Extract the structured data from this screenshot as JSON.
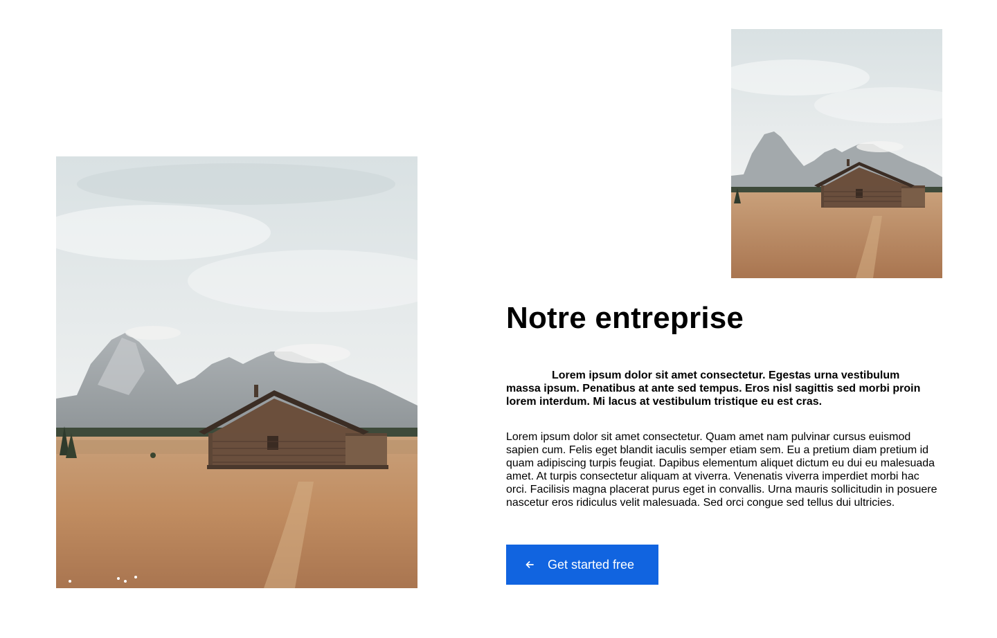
{
  "section": {
    "title": "Notre entreprise",
    "lead": "Lorem ipsum dolor sit amet consectetur. Egestas urna vestibulum massa ipsum. Penatibus at ante sed tempus. Eros nisl sagittis sed morbi proin lorem interdum. Mi lacus at vestibulum tristique eu est cras.",
    "body": "Lorem ipsum dolor sit amet consectetur. Quam amet nam pulvinar cursus euismod sapien cum. Felis eget blandit iaculis semper etiam sem. Eu a pretium diam pretium id quam adipiscing turpis feugiat. Dapibus elementum aliquet dictum eu dui eu malesuada amet. At turpis consectetur aliquam at viverra. Venenatis viverra imperdiet morbi hac orci. Facilisis magna placerat purus eget in convallis. Urna mauris sollicitudin in posuere nascetur eros ridiculus velit malesuada. Sed orci congue sed tellus dui ultricies."
  },
  "cta": {
    "label": "Get started free",
    "icon": "arrow-left-icon"
  },
  "images": {
    "large": "cabin-mountain-landscape",
    "small": "cabin-mountain-landscape"
  },
  "colors": {
    "accent": "#1164e0",
    "text": "#000000",
    "background": "#ffffff"
  }
}
